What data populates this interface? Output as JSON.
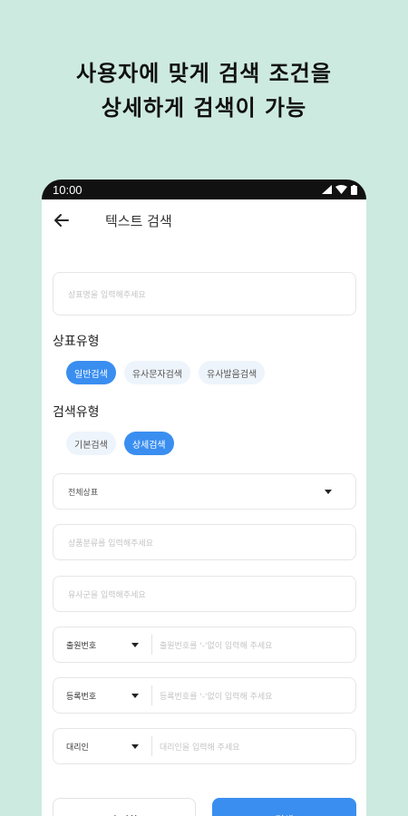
{
  "headline": {
    "line1": "사용자에 맞게 검색 조건을",
    "line2": "상세하게 검색이 가능"
  },
  "status_bar": {
    "time": "10:00"
  },
  "app_bar": {
    "title": "텍스트 검색"
  },
  "trademark_name_input": {
    "placeholder": "상표명을 입력해주세요"
  },
  "trademark_type": {
    "label": "상표유형",
    "options": [
      {
        "label": "일반검색",
        "selected": true
      },
      {
        "label": "유사문자검색",
        "selected": false
      },
      {
        "label": "유사발음검색",
        "selected": false
      }
    ]
  },
  "search_type": {
    "label": "검색유형",
    "options": [
      {
        "label": "기본검색",
        "selected": false
      },
      {
        "label": "상세검색",
        "selected": true
      }
    ]
  },
  "status_dropdown": {
    "value": "전체상표"
  },
  "product_class_input": {
    "placeholder": "상품분류를 입력해주세요"
  },
  "similar_group_input": {
    "placeholder": "유사군을 입력해주세요"
  },
  "application_number": {
    "select": "출원번호",
    "placeholder": "출원번호를 '-'없이 입력해 주세요"
  },
  "registration_number": {
    "select": "등록번호",
    "placeholder": "등록번호를 '-'없이 입력해 주세요"
  },
  "agent": {
    "select": "대리인",
    "placeholder": "대리인을 입력해 주세요"
  },
  "buttons": {
    "reset": "초기화",
    "search": "검색"
  },
  "colors": {
    "background": "#cdeae0",
    "accent": "#3a8ef0",
    "chip_inactive": "#eef4fb"
  }
}
